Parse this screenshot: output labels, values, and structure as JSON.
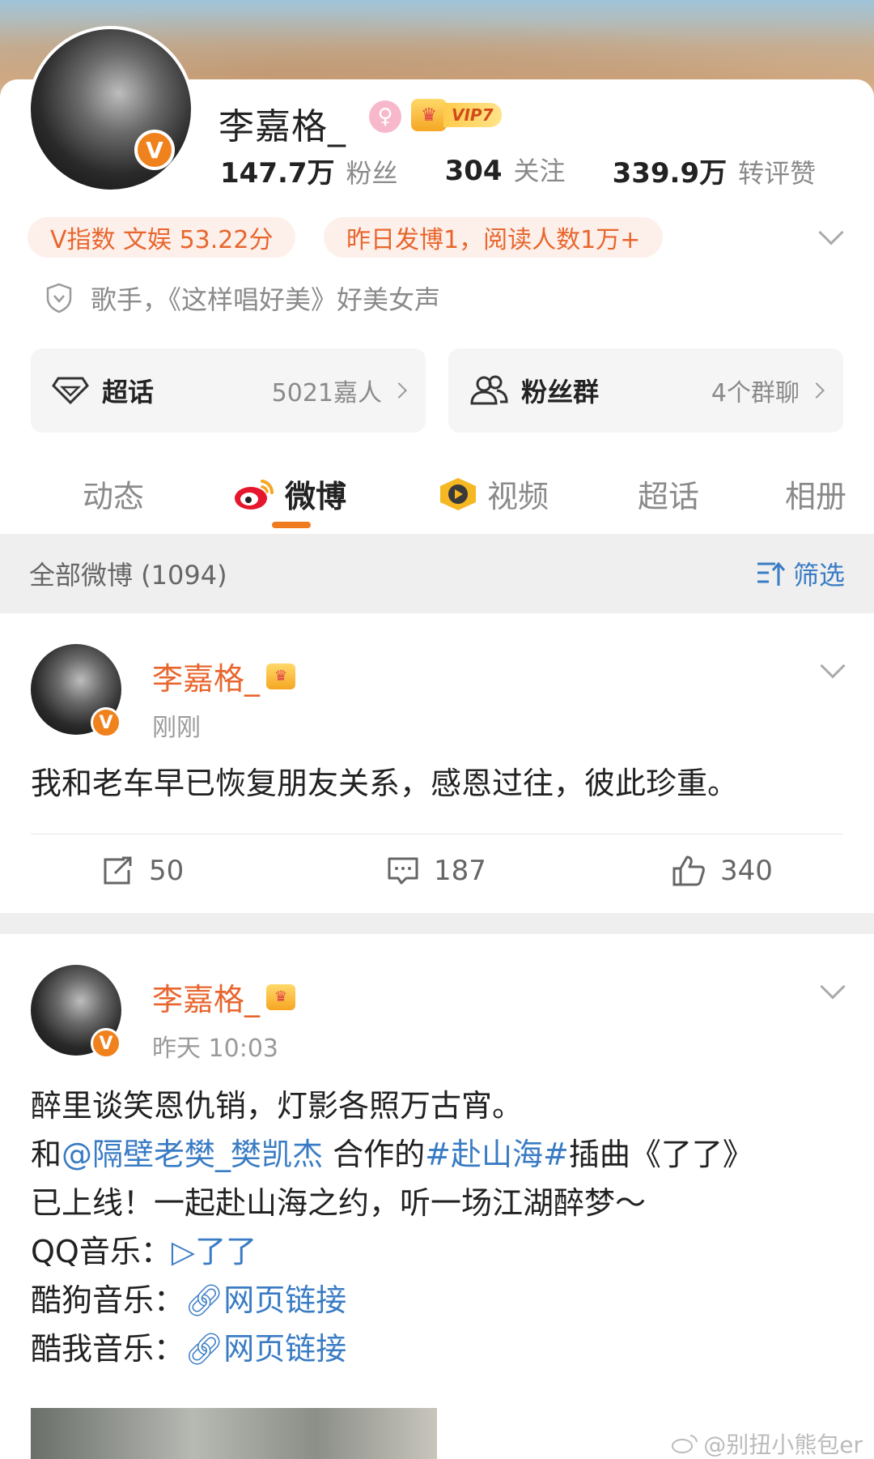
{
  "profile": {
    "name": "李嘉格_",
    "vip_label": "VIP7",
    "stats": [
      {
        "value": "147.7万",
        "label": "粉丝"
      },
      {
        "value": "304",
        "label": "关注"
      },
      {
        "value": "339.9万",
        "label": "转评赞"
      }
    ],
    "chips": [
      "V指数 文娱 53.22分",
      "昨日发博1，阅读人数1万+"
    ],
    "description": "歌手，《这样唱好美》好美女声",
    "supertopic": {
      "label": "超话",
      "count": "5021嘉人"
    },
    "fan_group": {
      "label": "粉丝群",
      "count": "4个群聊"
    }
  },
  "tabs": [
    {
      "label": "动态",
      "icon": "none"
    },
    {
      "label": "微博",
      "icon": "weibo-icon",
      "active": true
    },
    {
      "label": "视频",
      "icon": "video-icon"
    },
    {
      "label": "超话",
      "icon": "none"
    },
    {
      "label": "相册",
      "icon": "none"
    }
  ],
  "filter": {
    "all_label": "全部微博 (1094)",
    "filter_label": "筛选"
  },
  "posts": [
    {
      "author": "李嘉格_",
      "time": "刚刚",
      "text": "我和老车早已恢复朋友关系，感恩过往，彼此珍重。",
      "reposts": "50",
      "comments": "187",
      "likes": "340"
    },
    {
      "author": "李嘉格_",
      "time": "昨天 10:03",
      "line1": "醉里谈笑恩仇销，灯影各照万古宵。",
      "line2_a": "和",
      "line2_mention": "@隔壁老樊_樊凯杰",
      "line2_b": " 合作的",
      "line2_tag": "#赴山海#",
      "line2_c": "插曲《了了》",
      "line3": "已上线！一起赴山海之约，听一场江湖醉梦～",
      "qq_label": "QQ音乐：",
      "qq_link": "了了",
      "kugou_label": "酷狗音乐：",
      "kugou_link": "网页链接",
      "kuwo_label": "酷我音乐：",
      "kuwo_link": "网页链接"
    }
  ],
  "watermark": "@别扭小熊包er",
  "colors": {
    "accent": "#e8662e",
    "link": "#3a7cc4",
    "tab_indicator": "#f07a1e"
  }
}
